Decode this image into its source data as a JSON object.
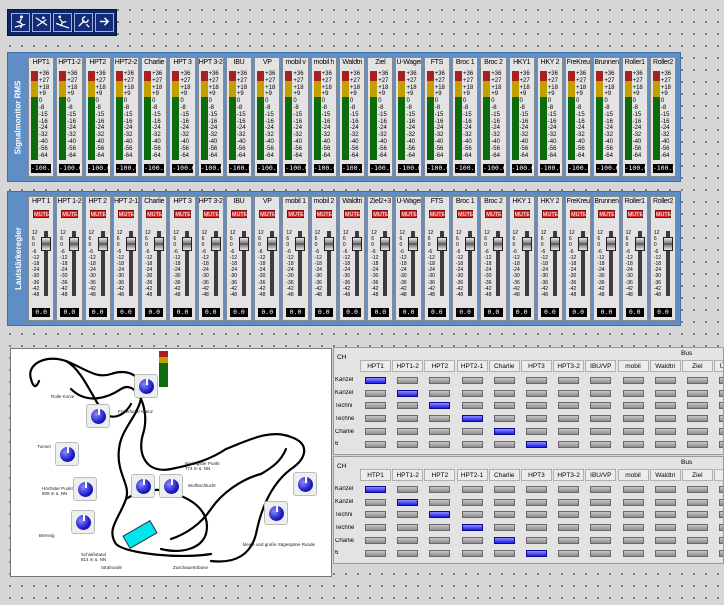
{
  "toolbar": {
    "buttons": [
      {
        "icon": "skier-icon"
      },
      {
        "icon": "ski-jump-icon"
      },
      {
        "icon": "skier-downhill-icon"
      },
      {
        "icon": "tools-icon"
      },
      {
        "icon": "arrow-icon"
      }
    ]
  },
  "rms_panel": {
    "label": "Signalmonitor RMS",
    "scale": [
      "+36",
      "+27",
      "+18",
      "+9",
      "0",
      "-8",
      "-15",
      "-16",
      "-24",
      "-32",
      "-40",
      "-56",
      "-64"
    ],
    "channels": [
      {
        "name": "HPT1",
        "value": "-100.0"
      },
      {
        "name": "HPT1-2",
        "value": "-100.0"
      },
      {
        "name": "HPT2",
        "value": "-100.0"
      },
      {
        "name": "HPT2-2",
        "value": "-100.0"
      },
      {
        "name": "Charlie",
        "value": "-100.0"
      },
      {
        "name": "HPT 3",
        "value": "-100.0"
      },
      {
        "name": "HPT 3-2",
        "value": "-100.0"
      },
      {
        "name": "IBU",
        "value": "-100.0"
      },
      {
        "name": "VP",
        "value": "-100.0"
      },
      {
        "name": "mobil v",
        "value": "-100.0"
      },
      {
        "name": "mobil h",
        "value": "-100.0"
      },
      {
        "name": "Waldtri",
        "value": "-100.0"
      },
      {
        "name": "Ziel",
        "value": "-100.0"
      },
      {
        "name": "Ü-Wagen",
        "value": "-100.0"
      },
      {
        "name": "FTS",
        "value": "-100.0"
      },
      {
        "name": "Broc 1",
        "value": "-100.0"
      },
      {
        "name": "Broc 2",
        "value": "-100.0"
      },
      {
        "name": "HKY1",
        "value": "-100.0"
      },
      {
        "name": "HKY 2",
        "value": "-100.0"
      },
      {
        "name": "FreKreu",
        "value": "-100.0"
      },
      {
        "name": "Brunnen",
        "value": "-100.0"
      },
      {
        "name": "Roller1",
        "value": "-100.0"
      },
      {
        "name": "Roller2",
        "value": "-100.0"
      }
    ]
  },
  "fader_panel": {
    "label": "Lautstärkeregler",
    "mute_label": "MUTE",
    "scale": [
      "12",
      "6",
      "0",
      "-6",
      "-12",
      "-18",
      "-24",
      "-30",
      "-36",
      "-42",
      "-48"
    ],
    "channels": [
      {
        "name": "HPT 1",
        "value": "0.0"
      },
      {
        "name": "HPT 1-2",
        "value": "0.0"
      },
      {
        "name": "HPT 2",
        "value": "0.0"
      },
      {
        "name": "HPT 2-1",
        "value": "0.0"
      },
      {
        "name": "Charlie",
        "value": "0.0"
      },
      {
        "name": "HPT 3",
        "value": "0.0"
      },
      {
        "name": "HPT 3-2",
        "value": "0.0"
      },
      {
        "name": "IBU",
        "value": "0.0"
      },
      {
        "name": "VP",
        "value": "0.0"
      },
      {
        "name": "mobil 1",
        "value": "0.0"
      },
      {
        "name": "mobil 2",
        "value": "0.0"
      },
      {
        "name": "Waldtri",
        "value": "0.0"
      },
      {
        "name": "Ziel2+3",
        "value": "0.0"
      },
      {
        "name": "Ü-Wagen",
        "value": "0.0"
      },
      {
        "name": "FTS",
        "value": "0.0"
      },
      {
        "name": "Broc 1",
        "value": "0.0"
      },
      {
        "name": "Broc 2",
        "value": "0.0"
      },
      {
        "name": "HKY 1",
        "value": "0.0"
      },
      {
        "name": "HKY 2",
        "value": "0.0"
      },
      {
        "name": "FreKreu",
        "value": "0.0"
      },
      {
        "name": "Brunnen",
        "value": "0.0"
      },
      {
        "name": "Roller1",
        "value": "0.0"
      },
      {
        "name": "Roller2",
        "value": "0.0"
      }
    ]
  },
  "map": {
    "labels": [
      {
        "id": "u",
        "text": "U"
      },
      {
        "id": "rolle",
        "text": "Rolle Kurve"
      },
      {
        "id": "frankfurter",
        "text": "Frankfurter Kreuz"
      },
      {
        "id": "tunnel",
        "text": "Tunnel"
      },
      {
        "id": "hochster",
        "text": "Höchster Punkt\n809 m ü. NN"
      },
      {
        "id": "brennig",
        "text": "Brennig"
      },
      {
        "id": "schiessstand",
        "text": "Schießstand\n814 m ü. NN"
      },
      {
        "id": "niedrigster",
        "text": "Niedrigster Punkt\n774 m ü. NN"
      },
      {
        "id": "wolfsschlucht",
        "text": "Wolfsschlucht"
      },
      {
        "id": "kleine_grosse",
        "text": "kleine und große Sägespäne Runde"
      },
      {
        "id": "strafrunde",
        "text": "Strafrunde"
      },
      {
        "id": "zuschauer",
        "text": "Zuschauertribüne"
      }
    ]
  },
  "matrix1": {
    "ch_label": "CH",
    "bus_label": "Bus",
    "columns": [
      "HPT1",
      "HPT1-2",
      "HPT2",
      "HPT2-1",
      "Charlie",
      "HPT3",
      "HPT3-2",
      "IBU/VP",
      "mobil",
      "Waldtri",
      "Ziel",
      "Ü-Wag"
    ],
    "rows": [
      {
        "label": "Kanzel",
        "on": 0
      },
      {
        "label": "Kanzel",
        "on": 1
      },
      {
        "label": "Techni",
        "on": 2
      },
      {
        "label": "Techne",
        "on": 3
      },
      {
        "label": "Charlie",
        "on": 4
      },
      {
        "label": "6",
        "on": 5
      }
    ]
  },
  "matrix2": {
    "ch_label": "CH",
    "bus_label": "Bus",
    "columns": [
      "HTP1",
      "HPT1-2",
      "HPT2",
      "HPT2-1",
      "Charlie",
      "HPT3",
      "HPT3-2",
      "IBU/VP",
      "mobil",
      "Waldtri",
      "Ziel",
      "Ü-W"
    ],
    "rows": [
      {
        "label": "Kanzel",
        "on": 0
      },
      {
        "label": "Kanzel",
        "on": 1
      },
      {
        "label": "Techni",
        "on": 2
      },
      {
        "label": "Techne",
        "on": 3
      },
      {
        "label": "Charlie",
        "on": 4
      },
      {
        "label": "6",
        "on": 5
      }
    ]
  },
  "colors": {
    "panel": "#5e8ec5",
    "toolbar": "#0d2464",
    "mute": "#d42a2a",
    "routing_on": "#1d1de0",
    "meter_green": "#0c6b0c",
    "meter_yellow": "#c2a000",
    "meter_red": "#a82020"
  }
}
